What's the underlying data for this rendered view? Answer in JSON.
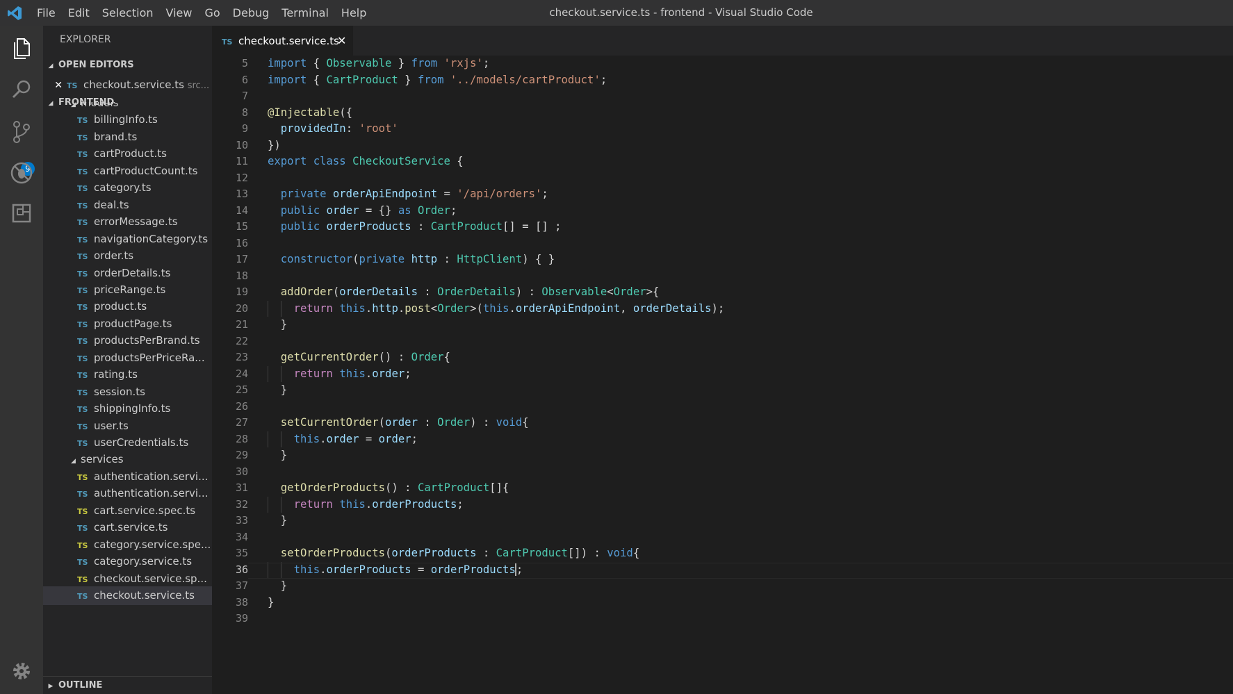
{
  "menu": [
    "File",
    "Edit",
    "Selection",
    "View",
    "Go",
    "Debug",
    "Terminal",
    "Help"
  ],
  "window_title": "checkout.service.ts - frontend - Visual Studio Code",
  "activity": {
    "scm_badge": "9"
  },
  "sidebar": {
    "title": "EXPLORER",
    "open_editors_label": "OPEN EDITORS",
    "open_editor": {
      "icon": "TS",
      "name": "checkout.service.ts",
      "path": "src..."
    },
    "workspace_label": "FRONTEND",
    "outline_label": "OUTLINE",
    "tree": [
      {
        "type": "folder",
        "label": "models"
      },
      {
        "type": "file",
        "label": "billingInfo.ts"
      },
      {
        "type": "file",
        "label": "brand.ts"
      },
      {
        "type": "file",
        "label": "cartProduct.ts"
      },
      {
        "type": "file",
        "label": "cartProductCount.ts"
      },
      {
        "type": "file",
        "label": "category.ts"
      },
      {
        "type": "file",
        "label": "deal.ts"
      },
      {
        "type": "file",
        "label": "errorMessage.ts"
      },
      {
        "type": "file",
        "label": "navigationCategory.ts"
      },
      {
        "type": "file",
        "label": "order.ts"
      },
      {
        "type": "file",
        "label": "orderDetails.ts"
      },
      {
        "type": "file",
        "label": "priceRange.ts"
      },
      {
        "type": "file",
        "label": "product.ts"
      },
      {
        "type": "file",
        "label": "productPage.ts"
      },
      {
        "type": "file",
        "label": "productsPerBrand.ts"
      },
      {
        "type": "file",
        "label": "productsPerPriceRa..."
      },
      {
        "type": "file",
        "label": "rating.ts"
      },
      {
        "type": "file",
        "label": "session.ts"
      },
      {
        "type": "file",
        "label": "shippingInfo.ts"
      },
      {
        "type": "file",
        "label": "user.ts"
      },
      {
        "type": "file",
        "label": "userCredentials.ts"
      },
      {
        "type": "folder",
        "label": "services"
      },
      {
        "type": "spec",
        "label": "authentication.servi..."
      },
      {
        "type": "file",
        "label": "authentication.servi..."
      },
      {
        "type": "spec",
        "label": "cart.service.spec.ts"
      },
      {
        "type": "file",
        "label": "cart.service.ts"
      },
      {
        "type": "spec",
        "label": "category.service.spe..."
      },
      {
        "type": "file",
        "label": "category.service.ts"
      },
      {
        "type": "spec",
        "label": "checkout.service.sp..."
      },
      {
        "type": "file",
        "label": "checkout.service.ts",
        "active": true
      }
    ],
    "ts_label": "TS"
  },
  "tab": {
    "icon": "TS",
    "label": "checkout.service.ts",
    "close": "✕"
  },
  "current_line": 36,
  "code": [
    {
      "n": 5,
      "i": 0,
      "t": [
        [
          "kw",
          "import"
        ],
        [
          "",
          "{ "
        ],
        [
          "ty",
          "Observable"
        ],
        [
          "",
          " } "
        ],
        [
          "kw",
          "from"
        ],
        [
          "",
          " "
        ],
        [
          "str",
          "'rxjs'"
        ],
        [
          "",
          ";"
        ]
      ]
    },
    {
      "n": 6,
      "i": 0,
      "t": [
        [
          "kw",
          "import"
        ],
        [
          "",
          "{ "
        ],
        [
          "ty",
          "CartProduct"
        ],
        [
          "",
          " } "
        ],
        [
          "kw",
          "from"
        ],
        [
          "",
          " "
        ],
        [
          "str",
          "'../models/cartProduct'"
        ],
        [
          "",
          ";"
        ]
      ]
    },
    {
      "n": 7,
      "i": 0,
      "t": []
    },
    {
      "n": 8,
      "i": 0,
      "t": [
        [
          "fn",
          "@Injectable"
        ],
        [
          "",
          "({"
        ]
      ]
    },
    {
      "n": 9,
      "i": 1,
      "t": [
        [
          "vr",
          "providedIn"
        ],
        [
          "",
          ": "
        ],
        [
          "str",
          "'root'"
        ]
      ]
    },
    {
      "n": 10,
      "i": 0,
      "t": [
        [
          "",
          "})"
        ]
      ]
    },
    {
      "n": 11,
      "i": 0,
      "t": [
        [
          "kw",
          "export"
        ],
        [
          "",
          " "
        ],
        [
          "kw",
          "class"
        ],
        [
          "",
          " "
        ],
        [
          "ty",
          "CheckoutService"
        ],
        [
          "",
          " {"
        ]
      ]
    },
    {
      "n": 12,
      "i": 0,
      "t": []
    },
    {
      "n": 13,
      "i": 1,
      "t": [
        [
          "kw",
          "private"
        ],
        [
          "",
          " "
        ],
        [
          "vr",
          "orderApiEndpoint"
        ],
        [
          "",
          " = "
        ],
        [
          "str",
          "'/api/orders'"
        ],
        [
          "",
          ";"
        ]
      ]
    },
    {
      "n": 14,
      "i": 1,
      "t": [
        [
          "kw",
          "public"
        ],
        [
          "",
          " "
        ],
        [
          "vr",
          "order"
        ],
        [
          "",
          " = {} "
        ],
        [
          "kw",
          "as"
        ],
        [
          "",
          " "
        ],
        [
          "ty",
          "Order"
        ],
        [
          "",
          ";"
        ]
      ]
    },
    {
      "n": 15,
      "i": 1,
      "t": [
        [
          "kw",
          "public"
        ],
        [
          "",
          " "
        ],
        [
          "vr",
          "orderProducts"
        ],
        [
          "",
          " : "
        ],
        [
          "ty",
          "CartProduct"
        ],
        [
          "",
          "[] = [] ;"
        ]
      ]
    },
    {
      "n": 16,
      "i": 0,
      "t": []
    },
    {
      "n": 17,
      "i": 1,
      "t": [
        [
          "kw",
          "constructor"
        ],
        [
          "",
          "("
        ],
        [
          "kw",
          "private"
        ],
        [
          "",
          " "
        ],
        [
          "vr",
          "http"
        ],
        [
          "",
          " : "
        ],
        [
          "ty",
          "HttpClient"
        ],
        [
          "",
          ") { }"
        ]
      ]
    },
    {
      "n": 18,
      "i": 0,
      "t": []
    },
    {
      "n": 19,
      "i": 1,
      "t": [
        [
          "fn",
          "addOrder"
        ],
        [
          "",
          "("
        ],
        [
          "vr",
          "orderDetails"
        ],
        [
          "",
          " : "
        ],
        [
          "ty",
          "OrderDetails"
        ],
        [
          "",
          ") : "
        ],
        [
          "ty",
          "Observable"
        ],
        [
          "",
          "<"
        ],
        [
          "ty",
          "Order"
        ],
        [
          "",
          ">{"
        ]
      ]
    },
    {
      "n": 20,
      "i": 2,
      "t": [
        [
          "ctl",
          "return"
        ],
        [
          "",
          " "
        ],
        [
          "kw",
          "this"
        ],
        [
          "",
          "."
        ],
        [
          "vr",
          "http"
        ],
        [
          "",
          "."
        ],
        [
          "fn",
          "post"
        ],
        [
          "",
          "<"
        ],
        [
          "ty",
          "Order"
        ],
        [
          "",
          ">("
        ],
        [
          "kw",
          "this"
        ],
        [
          "",
          "."
        ],
        [
          "vr",
          "orderApiEndpoint"
        ],
        [
          "",
          ", "
        ],
        [
          "vr",
          "orderDetails"
        ],
        [
          "",
          ");"
        ]
      ]
    },
    {
      "n": 21,
      "i": 1,
      "t": [
        [
          "",
          "}"
        ]
      ]
    },
    {
      "n": 22,
      "i": 0,
      "t": []
    },
    {
      "n": 23,
      "i": 1,
      "t": [
        [
          "fn",
          "getCurrentOrder"
        ],
        [
          "",
          "() : "
        ],
        [
          "ty",
          "Order"
        ],
        [
          "",
          "{"
        ]
      ]
    },
    {
      "n": 24,
      "i": 2,
      "t": [
        [
          "ctl",
          "return"
        ],
        [
          "",
          " "
        ],
        [
          "kw",
          "this"
        ],
        [
          "",
          "."
        ],
        [
          "vr",
          "order"
        ],
        [
          "",
          ";"
        ]
      ]
    },
    {
      "n": 25,
      "i": 1,
      "t": [
        [
          "",
          "}"
        ]
      ]
    },
    {
      "n": 26,
      "i": 0,
      "t": []
    },
    {
      "n": 27,
      "i": 1,
      "t": [
        [
          "fn",
          "setCurrentOrder"
        ],
        [
          "",
          "("
        ],
        [
          "vr",
          "order"
        ],
        [
          "",
          " : "
        ],
        [
          "ty",
          "Order"
        ],
        [
          "",
          ") : "
        ],
        [
          "kw",
          "void"
        ],
        [
          "",
          "{"
        ]
      ]
    },
    {
      "n": 28,
      "i": 2,
      "t": [
        [
          "kw",
          "this"
        ],
        [
          "",
          "."
        ],
        [
          "vr",
          "order"
        ],
        [
          "",
          " = "
        ],
        [
          "vr",
          "order"
        ],
        [
          "",
          ";"
        ]
      ]
    },
    {
      "n": 29,
      "i": 1,
      "t": [
        [
          "",
          "}"
        ]
      ]
    },
    {
      "n": 30,
      "i": 0,
      "t": []
    },
    {
      "n": 31,
      "i": 1,
      "t": [
        [
          "fn",
          "getOrderProducts"
        ],
        [
          "",
          "() : "
        ],
        [
          "ty",
          "CartProduct"
        ],
        [
          "",
          "[]{"
        ]
      ]
    },
    {
      "n": 32,
      "i": 2,
      "t": [
        [
          "ctl",
          "return"
        ],
        [
          "",
          " "
        ],
        [
          "kw",
          "this"
        ],
        [
          "",
          "."
        ],
        [
          "vr",
          "orderProducts"
        ],
        [
          "",
          ";"
        ]
      ]
    },
    {
      "n": 33,
      "i": 1,
      "t": [
        [
          "",
          "}"
        ]
      ]
    },
    {
      "n": 34,
      "i": 0,
      "t": []
    },
    {
      "n": 35,
      "i": 1,
      "t": [
        [
          "fn",
          "setOrderProducts"
        ],
        [
          "",
          "("
        ],
        [
          "vr",
          "orderProducts"
        ],
        [
          "",
          " : "
        ],
        [
          "ty",
          "CartProduct"
        ],
        [
          "",
          "[]) : "
        ],
        [
          "kw",
          "void"
        ],
        [
          "",
          "{"
        ]
      ]
    },
    {
      "n": 36,
      "i": 2,
      "t": [
        [
          "kw",
          "this"
        ],
        [
          "",
          "."
        ],
        [
          "vr",
          "orderProducts"
        ],
        [
          "",
          " = "
        ],
        [
          "vr",
          "orderProducts"
        ],
        [
          "cursor",
          ""
        ],
        [
          "",
          ";"
        ]
      ]
    },
    {
      "n": 37,
      "i": 1,
      "t": [
        [
          "",
          "}"
        ]
      ]
    },
    {
      "n": 38,
      "i": 0,
      "t": [
        [
          "",
          "}"
        ]
      ]
    },
    {
      "n": 39,
      "i": 0,
      "t": []
    }
  ]
}
